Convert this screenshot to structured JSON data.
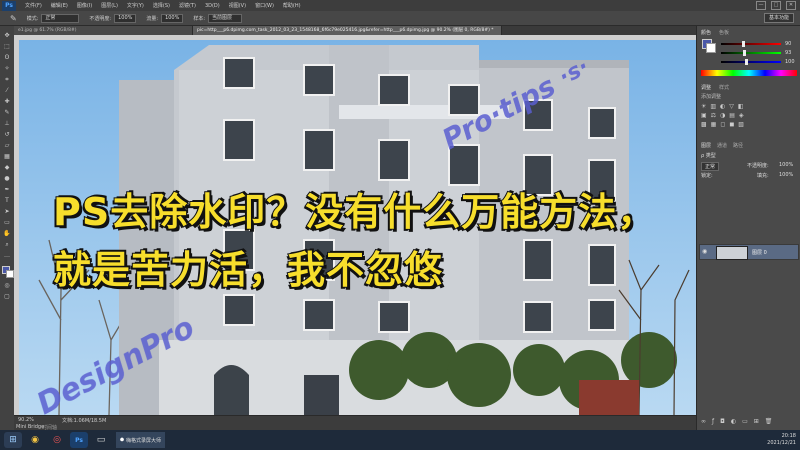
{
  "app": {
    "logo": "Ps"
  },
  "menu": [
    "文件(F)",
    "编辑(E)",
    "图像(I)",
    "图层(L)",
    "文字(Y)",
    "选择(S)",
    "滤镜(T)",
    "3D(D)",
    "视图(V)",
    "窗口(W)",
    "帮助(H)"
  ],
  "window_buttons": [
    "—",
    "□",
    "✕"
  ],
  "options": {
    "mode_label": "模式:",
    "mode_value": "正常",
    "opacity_label": "不透明度:",
    "opacity_value": "100%",
    "flow_label": "流量:",
    "flow_value": "100%",
    "sample_label": "样本:",
    "sample_value": "当前图层",
    "workspace": "基本功能"
  },
  "tabs": [
    "e1.jpg @ 61.7% (RGB/8#)",
    "pic=http___p6.dpimg.com_task_2012_03_23_1548168_6f6c79e025416.jpg&refer=http___p6.dpimg.jpg @ 90.2% (图层 0, RGB/8#) *"
  ],
  "caption": {
    "line1": "PS去除水印？没有什么万能方法，",
    "line2": "就是苦力活，我不忽悠"
  },
  "status": {
    "zoom": "90.2%",
    "doc": "文档:1.06M/18.5M",
    "mini_bridge": "Mini Bridge",
    "timeline": "时间轴"
  },
  "panels": {
    "color_tab": "颜色",
    "swatches_tab": "色板",
    "adjust_tab": "调整",
    "styles_tab": "样式",
    "adjust_title": "添加调整",
    "layers_tab": "图层",
    "channels_tab": "通道",
    "paths_tab": "路径",
    "kind_label": "ρ 类型",
    "blend_value": "正常",
    "opacity_label": "不透明度:",
    "opacity_value": "100%",
    "lock_label": "锁定:",
    "fill_label": "填充:",
    "fill_value": "100%",
    "layer_name": "图层 0",
    "color_values": {
      "r": 90,
      "g": 93,
      "b": 100
    }
  },
  "colors": {
    "foreground": "#4b58a8",
    "background": "#ffffff",
    "caption": "#f7de2c",
    "watermark": "#5a5fd0"
  },
  "taskbar": {
    "app_label": "Ps",
    "recording_label": "嗨格式录屏大师",
    "time": "20:18",
    "date": "2021/12/21"
  },
  "watermark_text": "DesignPro·tips·s"
}
